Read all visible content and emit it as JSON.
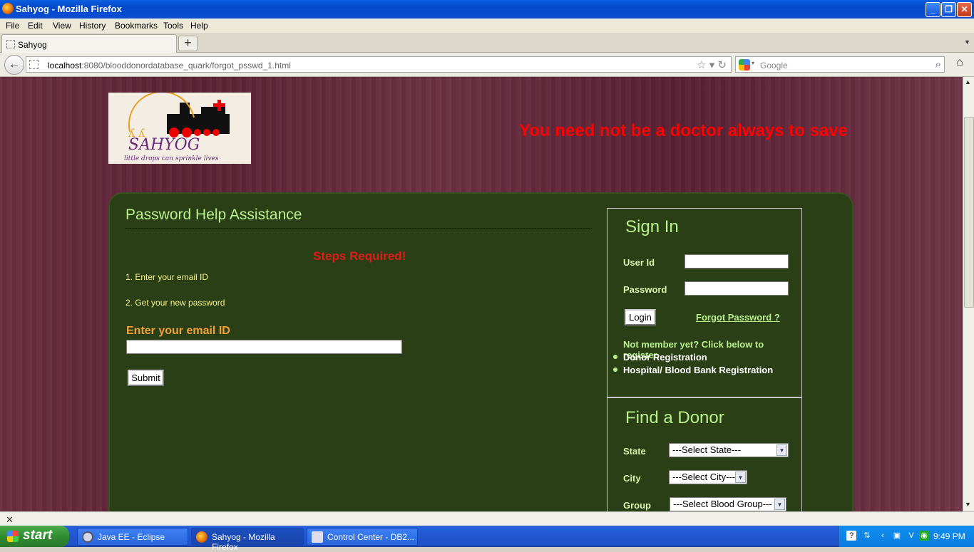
{
  "window": {
    "title": "Sahyog - Mozilla Firefox"
  },
  "menu": [
    "File",
    "Edit",
    "View",
    "History",
    "Bookmarks",
    "Tools",
    "Help"
  ],
  "tab": {
    "label": "Sahyog",
    "new_tab": "+"
  },
  "nav": {
    "url_host": "localhost",
    "url_rest": ":8080/blooddonordatabase_quark/forgot_psswd_1.html",
    "search_placeholder": "Google"
  },
  "page": {
    "slogan": "You need not be a doctor always to save",
    "heading": "Password Help Assistance",
    "steps_title": "Steps Required!",
    "step1": "1. Enter your email ID",
    "step2": "2. Get your new password",
    "email_label": "Enter your email ID",
    "email_value": "",
    "submit_label": "Submit",
    "logo_alt": "SAHYOG",
    "logo_tagline": "little drops can sprinkle lives"
  },
  "signin": {
    "heading": "Sign In",
    "user_label": "User Id",
    "password_label": "Password",
    "login_label": "Login",
    "forgot_label": "Forgot Password ?",
    "not_member": "Not member yet? Click below to register.",
    "links": [
      "Donor Registration",
      "Hospital/ Blood Bank Registration"
    ]
  },
  "find_donor": {
    "heading": "Find a Donor",
    "state_label": "State",
    "state_value": "---Select State---",
    "city_label": "City",
    "city_value": "---Select City---",
    "group_label": "Group",
    "group_value": "---Select Blood Group---"
  },
  "taskbar": {
    "start": "start",
    "tasks": [
      "Java EE - Eclipse",
      "Sahyog - Mozilla Firefox",
      "Control Center - DB2..."
    ],
    "time": "9:49 PM"
  },
  "colors": {
    "panel": "#2b3f17",
    "heading_green": "#b8f08c",
    "red": "#ff0000",
    "orange": "#f0a238"
  }
}
